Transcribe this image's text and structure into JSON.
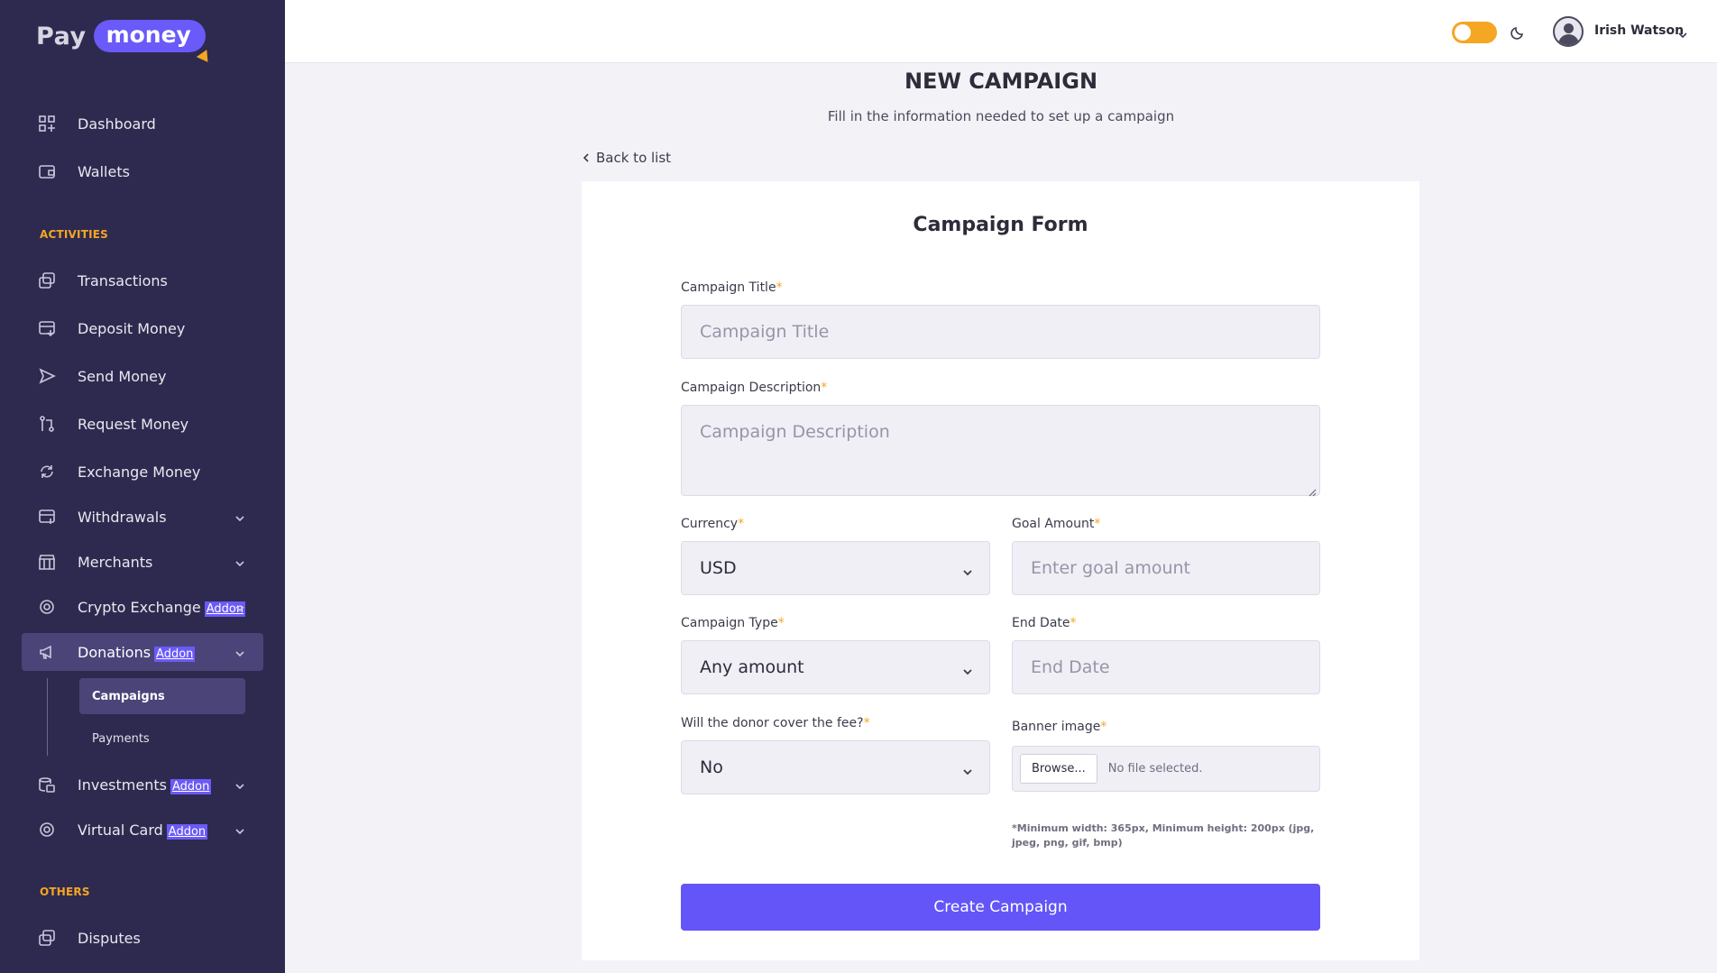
{
  "brand": {
    "pay": "Pay",
    "money": "money"
  },
  "sidebar": {
    "main_items": [
      {
        "label": "Dashboard"
      },
      {
        "label": "Wallets"
      }
    ],
    "activities_title": "ACTIVITIES",
    "activities": [
      {
        "label": "Transactions"
      },
      {
        "label": "Deposit Money"
      },
      {
        "label": "Send Money"
      },
      {
        "label": "Request Money"
      },
      {
        "label": "Exchange Money"
      },
      {
        "label": "Withdrawals"
      },
      {
        "label": "Merchants"
      },
      {
        "label": "Crypto Exchange",
        "badge": "Addon"
      },
      {
        "label": "Donations",
        "badge": "Addon"
      },
      {
        "label": "Investments",
        "badge": "Addon"
      },
      {
        "label": "Virtual Card",
        "badge": "Addon"
      }
    ],
    "donations_sub": [
      {
        "label": "Campaigns"
      },
      {
        "label": "Payments"
      }
    ],
    "others_title": "OTHERS",
    "others": [
      {
        "label": "Disputes"
      }
    ]
  },
  "topbar": {
    "user_name": "Irish Watson",
    "dark_mode": false
  },
  "page": {
    "title": "NEW CAMPAIGN",
    "subtitle": "Fill in the information needed to set up a campaign",
    "back_link": "Back to list"
  },
  "form": {
    "title": "Campaign Form",
    "required_mark": "*",
    "campaign_title": {
      "label": "Campaign Title",
      "placeholder": "Campaign Title"
    },
    "campaign_description": {
      "label": "Campaign Description",
      "placeholder": "Campaign Description"
    },
    "currency": {
      "label": "Currency",
      "value": "USD"
    },
    "goal_amount": {
      "label": "Goal Amount",
      "placeholder": "Enter goal amount"
    },
    "campaign_type": {
      "label": "Campaign Type",
      "value": "Any amount"
    },
    "end_date": {
      "label": "End Date",
      "placeholder": "End Date"
    },
    "donor_fee": {
      "label": "Will the donor cover the fee?",
      "value": "No"
    },
    "banner_image": {
      "label": "Banner image",
      "browse_label": "Browse...",
      "file_status": "No file selected.",
      "hint": "*Minimum width: 365px, Minimum height: 200px (jpg, jpeg, png, gif, bmp)"
    },
    "submit_label": "Create Campaign"
  },
  "colors": {
    "sidebar": "#2e2a4f",
    "accent": "#6355f7",
    "highlight": "#f5a623"
  },
  "icons": [
    "dashboard-icon",
    "wallet-icon",
    "transactions-icon",
    "deposit-icon",
    "send-icon",
    "request-icon",
    "exchange-icon",
    "withdrawals-icon",
    "merchants-icon",
    "crypto-icon",
    "megaphone-icon",
    "investments-icon",
    "virtual-card-icon",
    "disputes-icon",
    "moon-icon",
    "chevron-down-icon",
    "chevron-left-icon"
  ]
}
